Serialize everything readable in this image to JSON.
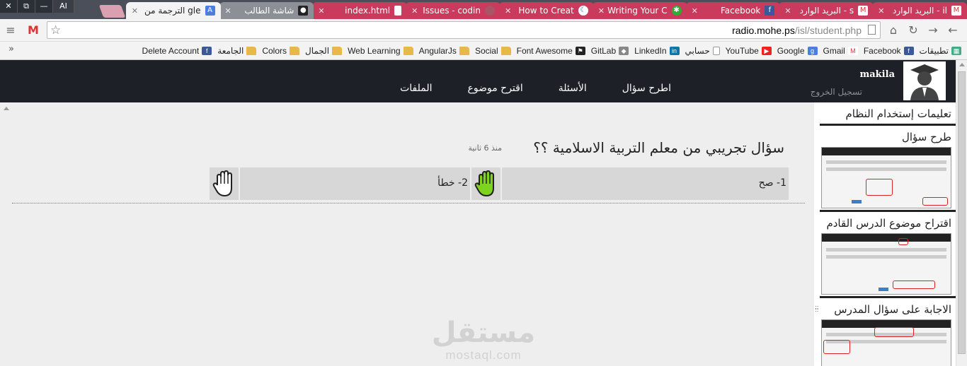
{
  "window": {
    "buttons": [
      "✕",
      "⧉",
      "—",
      "AI"
    ]
  },
  "tabs": [
    {
      "title": "البريد الوارد - il",
      "favicon": "gmail-icon",
      "state": "inactive"
    },
    {
      "title": "البريد الوارد - s",
      "favicon": "gmail-icon",
      "state": "inactive"
    },
    {
      "title": "Facebook",
      "favicon": "facebook-icon",
      "state": "inactive"
    },
    {
      "title": "Writing Your C",
      "favicon": "angular-icon",
      "state": "inactive"
    },
    {
      "title": "How to Creat",
      "favicon": "moon-icon",
      "state": "inactive"
    },
    {
      "title": "Issues - codin",
      "favicon": "codin-icon",
      "state": "inactive"
    },
    {
      "title": "index.html",
      "favicon": "page-icon",
      "state": "inactive"
    },
    {
      "title": "شاشة الطالب",
      "favicon": "user-icon",
      "state": "inactive-grey"
    },
    {
      "title": "الترجمة من gle",
      "favicon": "translate-icon",
      "state": "active"
    }
  ],
  "toolbar": {
    "url_host": "radio.mohe.ps",
    "url_path": "/isl/student.php"
  },
  "bookmarks": [
    {
      "label": "تطبيقات",
      "icon": "apps-icon",
      "color": "#4a8"
    },
    {
      "label": "Facebook",
      "icon": "facebook-icon",
      "color": "#3b5998"
    },
    {
      "label": "Gmail",
      "icon": "gmail-icon",
      "color": "#d33"
    },
    {
      "label": "Google",
      "icon": "google-icon",
      "color": "#4a7fe0"
    },
    {
      "label": "YouTube",
      "icon": "youtube-icon",
      "color": "#e22"
    },
    {
      "label": "حسابي",
      "icon": "page-icon",
      "color": "#fff"
    },
    {
      "label": "LinkedIn",
      "icon": "linkedin-icon",
      "color": "#0e76a8"
    },
    {
      "label": "GitLab",
      "icon": "gitlab-icon",
      "color": "#888"
    },
    {
      "label": "Font Awesome",
      "icon": "flag-icon",
      "color": "#222"
    },
    {
      "label": "Social",
      "icon": "folder-icon",
      "color": "#e8b84a"
    },
    {
      "label": "AngularJs",
      "icon": "folder-icon",
      "color": "#e8b84a"
    },
    {
      "label": "Web Learning",
      "icon": "folder-icon",
      "color": "#e8b84a"
    },
    {
      "label": "الجمال",
      "icon": "folder-icon",
      "color": "#e8b84a"
    },
    {
      "label": "Colors",
      "icon": "folder-icon",
      "color": "#e8b84a"
    },
    {
      "label": "الجامعة",
      "icon": "folder-icon",
      "color": "#e8b84a"
    },
    {
      "label": "Delete Account",
      "icon": "facebook-icon",
      "color": "#3b5998"
    }
  ],
  "header": {
    "user_name": "makila",
    "logout_label": "تسجيل الخروج",
    "nav": [
      "اطرح سؤال",
      "الأسئلة",
      "اقترح موضوع",
      "الملفات"
    ]
  },
  "question": {
    "title": "سؤال تجريبي من معلم التربية الاسلامية ؟؟",
    "time": "منذ 6 ثانية",
    "answers": [
      "1- صح",
      "2- خطأ"
    ]
  },
  "watermark": {
    "logo": "مستقل",
    "sub": "mostaql.com"
  },
  "sidebar": {
    "title": "تعليمات إستخدام النظام",
    "blocks": [
      "طرح سؤال",
      "اقتراح موضوع الدرس القادم",
      "الاجابة على سؤال المدرس"
    ]
  },
  "colors": {
    "tab_accent": "#c93a5c",
    "header_bg": "#1d2026",
    "main_bg": "#eeeeee",
    "answer_bg": "#d7d7d7",
    "hand_selected": "#7ed321"
  }
}
